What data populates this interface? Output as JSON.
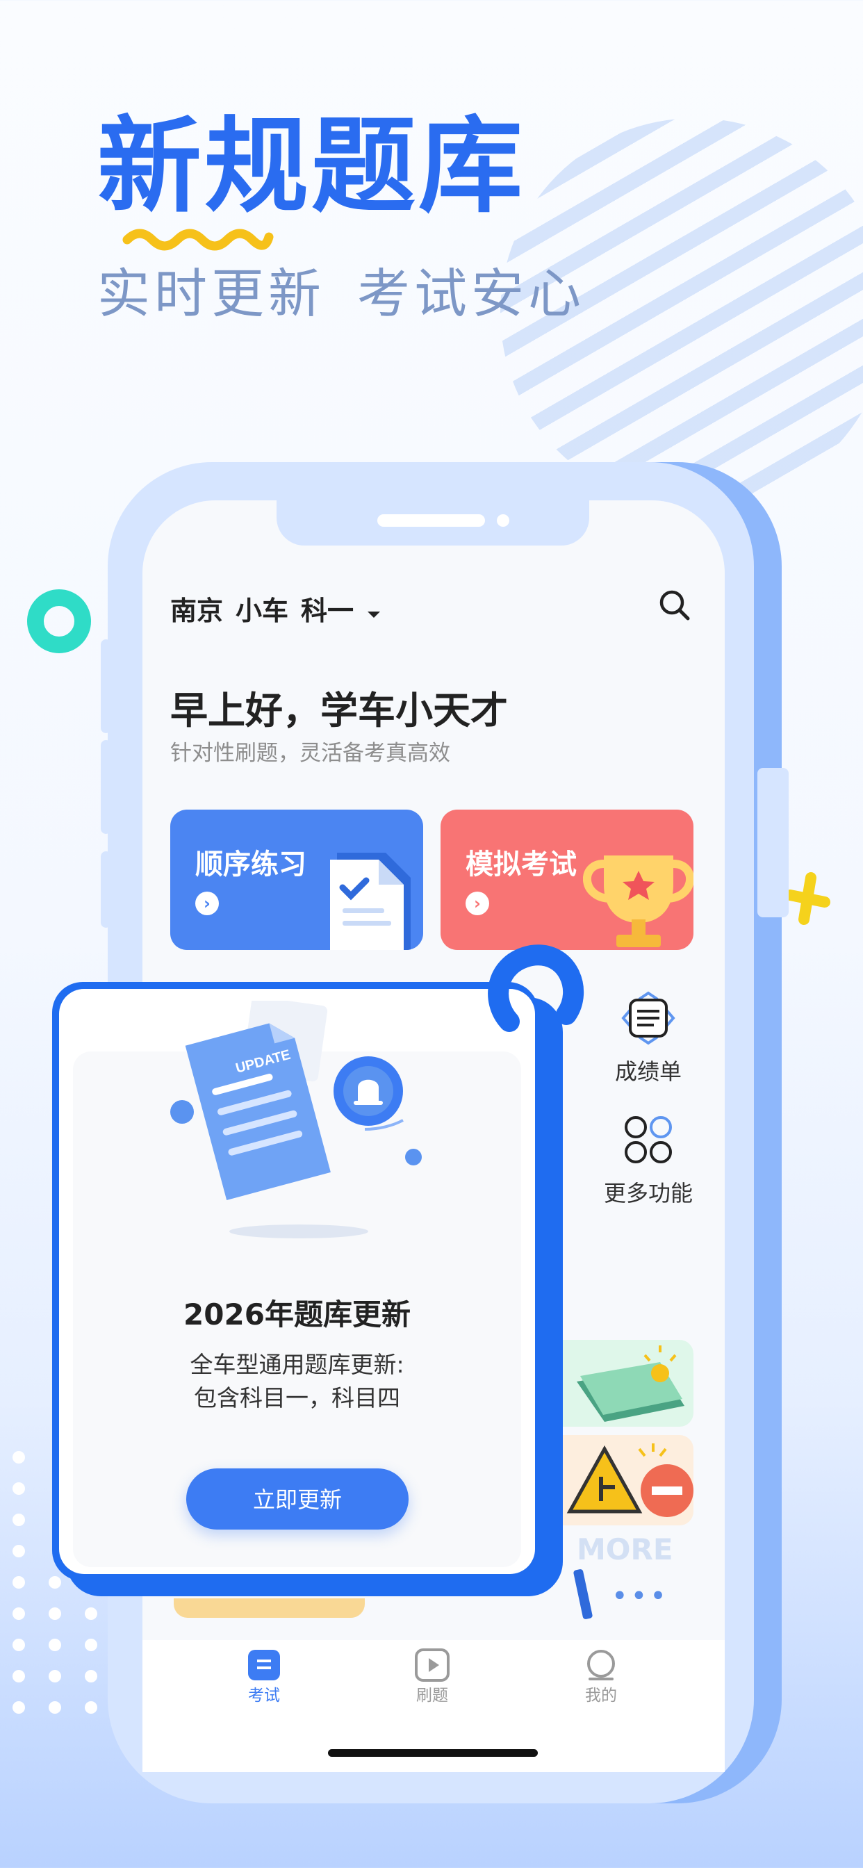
{
  "hero": {
    "title": "新规题库",
    "subtitle_1": "实时更新",
    "subtitle_2": "考试安心"
  },
  "header": {
    "city": "南京",
    "vehicle": "小车",
    "subject": "科一"
  },
  "greeting": {
    "title": "早上好，学车小天才",
    "subtitle": "针对性刷题，灵活备考真高效"
  },
  "cards": [
    {
      "label": "顺序练习",
      "color": "#4b85f2"
    },
    {
      "label": "模拟考试",
      "color": "#f87474"
    }
  ],
  "functions": [
    {
      "label": "成绩单"
    },
    {
      "label": "更多功能"
    }
  ],
  "banner": {
    "more_text": "MORE",
    "doc_text": "UPDATE"
  },
  "modal": {
    "title": "2026年题库更新",
    "desc_line1": "全车型通用题库更新:",
    "desc_line2": "包含科目一，科目四",
    "button": "立即更新"
  },
  "tabbar": [
    {
      "label": "考试",
      "active": true
    },
    {
      "label": "刷题",
      "active": false
    },
    {
      "label": "我的",
      "active": false
    }
  ],
  "colors": {
    "accent": "#2a6cf0",
    "teal": "#2fdcc7",
    "yellow": "#f5d21c",
    "active_tab": "#3d7cf3",
    "inactive_tab": "#9a9a9a"
  }
}
